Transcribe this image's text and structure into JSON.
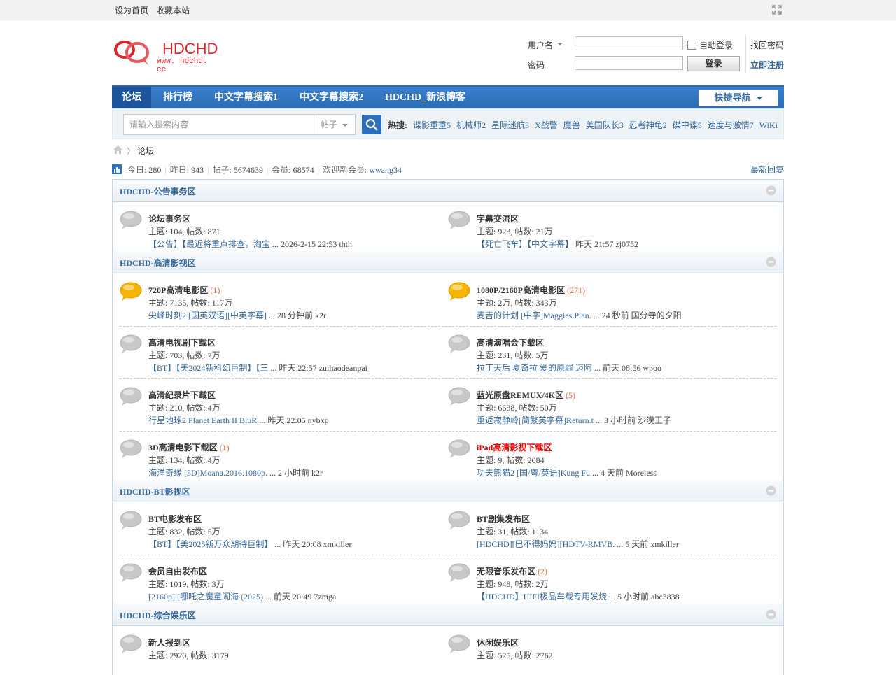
{
  "topbar": {
    "set_home": "设为首页",
    "bookmark": "收藏本站"
  },
  "logo": {
    "brand": "HDCHD",
    "url": "www. hdchd. cc"
  },
  "login": {
    "username_label": "用户名",
    "password_label": "密码",
    "auto_login": "自动登录",
    "login_button": "登录",
    "forgot": "找回密码",
    "register": "立即注册"
  },
  "nav": {
    "items": [
      "论坛",
      "排行榜",
      "中文字幕搜索1",
      "中文字幕搜索2",
      "HDCHD_新浪博客"
    ],
    "quick_nav": "快捷导航"
  },
  "search": {
    "placeholder": "请输入搜索内容",
    "type": "帖子",
    "hot_label": "热搜:",
    "hot": [
      "谍影重重5",
      "机械师2",
      "星际迷航3",
      "X战警",
      "魔兽",
      "美国队长3",
      "忍者神龟2",
      "碟中谍5",
      "速度与激情7",
      "WiKi"
    ]
  },
  "breadcrumb": {
    "current": "论坛"
  },
  "stats": {
    "today_label": "今日:",
    "today": "280",
    "yesterday_label": "昨日:",
    "yesterday": "943",
    "posts_label": "帖子:",
    "posts": "5674639",
    "members_label": "会员:",
    "members": "68574",
    "welcome_label": "欢迎新会员:",
    "newest": "wwang34",
    "latest_replies": "最新回复"
  },
  "sections": [
    {
      "title": "HDCHD-公告事务区",
      "forums": [
        {
          "name": "论坛事务区",
          "new": "",
          "counts": "主题: 104, 帖数: 871",
          "last_title": "【公告】【最近将重点排查，淘宝",
          "last_meta": " ... 2026-2-15 22:53 thth",
          "hot": false,
          "red": false
        },
        {
          "name": "字幕交流区",
          "new": "",
          "counts": "主题: 923, 帖数: 21万",
          "last_title": "【死亡飞车】【中文字幕】",
          "last_meta": " 昨天 21:57 zj0752",
          "hot": false,
          "red": false
        }
      ]
    },
    {
      "title": "HDCHD-高清影视区",
      "forums": [
        {
          "name": "720P高清电影区",
          "new": "(1)",
          "counts": "主题: 7135, 帖数: 117万",
          "last_title": "尖峰时刻2 [国英双语][中英字幕]",
          "last_meta": " ... 28 分钟前 k2r",
          "hot": true,
          "red": false
        },
        {
          "name": "1080P/2160P高清电影区",
          "new": "(271)",
          "counts": "主题: 2万, 帖数: 343万",
          "last_title": "麦吉的计划 [中字]Maggies.Plan.",
          "last_meta": " ... 24 秒前 国分寺的夕阳",
          "hot": true,
          "red": false
        },
        {
          "name": "高清电视剧下载区",
          "new": "",
          "counts": "主题: 703, 帖数: 7万",
          "last_title": "【BT】【美2024新科幻巨制】【三",
          "last_meta": " ... 昨天 22:57 zuihaodeanpai",
          "hot": false,
          "red": false
        },
        {
          "name": "高清演唱会下载区",
          "new": "",
          "counts": "主题: 231, 帖数: 5万",
          "last_title": "拉丁天后 夏奇拉 爱的原罪 迈阿",
          "last_meta": " ... 前天 08:56 wpoo",
          "hot": false,
          "red": false
        },
        {
          "name": "高清纪录片下载区",
          "new": "",
          "counts": "主题: 210, 帖数: 4万",
          "last_title": "行星地球2 Planet Earth II BluR",
          "last_meta": " ... 昨天 22:05 nybxp",
          "hot": false,
          "red": false
        },
        {
          "name": "蓝光原盘REMUX/4K区",
          "new": "(5)",
          "counts": "主题: 6638, 帖数: 50万",
          "last_title": "重返寂静岭[简繁英字幕]Return.t",
          "last_meta": " ... 3 小时前 沙漠王子",
          "hot": false,
          "red": false
        },
        {
          "name": "3D高清电影下载区",
          "new": "(1)",
          "counts": "主题: 134, 帖数: 4万",
          "last_title": "海洋奇缘 [3D]Moana.2016.1080p.",
          "last_meta": " ... 2 小时前 k2r",
          "hot": false,
          "red": false
        },
        {
          "name": "iPad高清影视下载区",
          "new": "",
          "counts": "主题: 9, 帖数: 2084",
          "last_title": "功夫熊猫2 [国/粤/英语]Kung Fu",
          "last_meta": " ... 4 天前 Moreless",
          "hot": false,
          "red": true
        }
      ]
    },
    {
      "title": "HDCHD-BT影视区",
      "forums": [
        {
          "name": "BT电影发布区",
          "new": "",
          "counts": "主题: 832, 帖数: 5万",
          "last_title": "【BT】【美2025新万众期待巨制】",
          "last_meta": " ... 昨天 20:08 xmkiller",
          "hot": false,
          "red": false
        },
        {
          "name": "BT剧集发布区",
          "new": "",
          "counts": "主题: 31, 帖数: 1134",
          "last_title": "[HDCHD][巴不得妈妈][HDTV-RMVB.",
          "last_meta": " ... 5 天前 xmkiller",
          "hot": false,
          "red": false
        },
        {
          "name": "会员自由发布区",
          "new": "",
          "counts": "主题: 1019, 帖数: 3万",
          "last_title": "[2160p] [哪吒之魔童闹海 (2025)",
          "last_meta": " ... 前天 20:49 7zmga",
          "hot": false,
          "red": false
        },
        {
          "name": "无限音乐发布区",
          "new": "(2)",
          "counts": "主题: 948, 帖数: 2万",
          "last_title": "【HDCHD】HIFI极品车载专用发烧",
          "last_meta": " ... 5 小时前 abc3838",
          "hot": false,
          "red": false
        }
      ]
    },
    {
      "title": "HDCHD-综合娱乐区",
      "forums": [
        {
          "name": "新人报到区",
          "new": "",
          "counts": "主题: 2920, 帖数: 3179",
          "last_title": "",
          "last_meta": "",
          "hot": false,
          "red": false
        },
        {
          "name": "休闲娱乐区",
          "new": "",
          "counts": "主题: 525, 帖数: 2762",
          "last_title": "",
          "last_meta": "",
          "hot": false,
          "red": false
        }
      ]
    }
  ]
}
